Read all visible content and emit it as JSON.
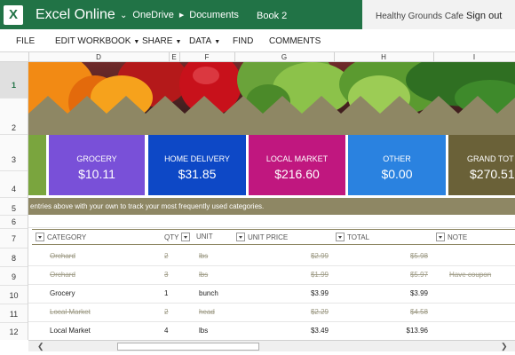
{
  "header": {
    "app_name": "Excel Online",
    "logo_letter": "X",
    "breadcrumb": {
      "location": "OneDrive",
      "folder": "Documents"
    },
    "workbook_name": "Book 2",
    "owner": "Healthy Grounds Cafe",
    "signout_label": "Sign out"
  },
  "menu": {
    "file": "FILE",
    "edit": "EDIT WORKBOOK",
    "share": "SHARE",
    "data": "DATA",
    "find": "FIND",
    "comments": "COMMENTS"
  },
  "columns": [
    "D",
    "E",
    "F",
    "G",
    "H",
    "I"
  ],
  "rows": [
    "1",
    "2",
    "3",
    "4",
    "5",
    "6",
    "7",
    "8",
    "9",
    "10",
    "11",
    "12"
  ],
  "tiles": [
    {
      "label": "GROCERY",
      "value": "$10.11",
      "color": "#7950d8"
    },
    {
      "label": "HOME DELIVERY",
      "value": "$31.85",
      "color": "#0d48c6"
    },
    {
      "label": "LOCAL MARKET",
      "value": "$216.60",
      "color": "#c0177f"
    },
    {
      "label": "OTHER",
      "value": "$0.00",
      "color": "#2a82e0"
    },
    {
      "label": "GRAND TOT",
      "value": "$270.51",
      "color": "#6a6138"
    }
  ],
  "instruction": "entries above with your own to track your most frequently used categories.",
  "table": {
    "headers": {
      "category": "CATEGORY",
      "qty": "QTY",
      "unit": "UNIT",
      "unit_price": "UNIT PRICE",
      "total": "TOTAL",
      "note": "NOTE"
    },
    "rows": [
      {
        "category": "Orchard",
        "qty": "2",
        "unit": "lbs",
        "unit_price": "$2.99",
        "total": "$5.98",
        "note": "",
        "done": true
      },
      {
        "category": "Orchard",
        "qty": "3",
        "unit": "lbs",
        "unit_price": "$1.99",
        "total": "$5.97",
        "note": "Have coupon",
        "done": true
      },
      {
        "category": "Grocery",
        "qty": "1",
        "unit": "bunch",
        "unit_price": "$3.99",
        "total": "$3.99",
        "note": "",
        "done": false
      },
      {
        "category": "Local Market",
        "qty": "2",
        "unit": "head",
        "unit_price": "$2.29",
        "total": "$4.58",
        "note": "",
        "done": true
      },
      {
        "category": "Local Market",
        "qty": "4",
        "unit": "lbs",
        "unit_price": "$3.49",
        "total": "$13.96",
        "note": "",
        "done": false
      }
    ]
  },
  "colors": {
    "excel_green": "#217346",
    "olive": "#8e8764",
    "strike_text": "#a09d88"
  }
}
